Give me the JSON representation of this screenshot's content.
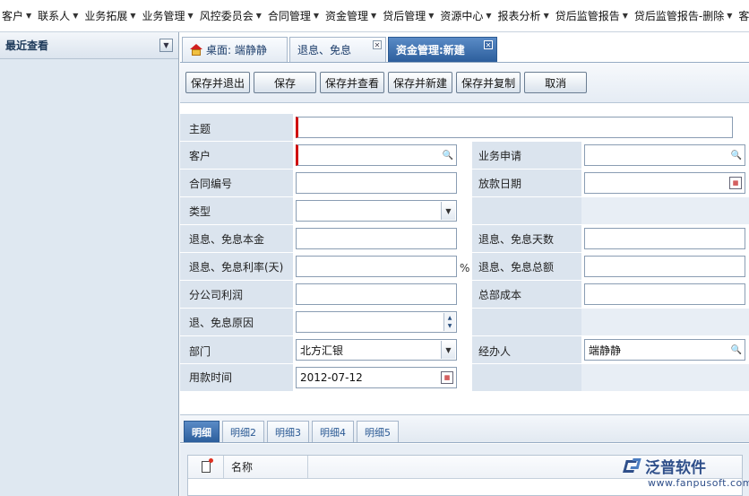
{
  "menubar": {
    "items": [
      "客户",
      "联系人",
      "业务拓展",
      "业务管理",
      "风控委员会",
      "合同管理",
      "资金管理",
      "贷后管理",
      "资源中心",
      "报表分析",
      "贷后监管报告",
      "贷后监管报告-删除",
      "客户安"
    ]
  },
  "leftpanel": {
    "title": "最近查看"
  },
  "tabs": {
    "home": "桌面: 端静静",
    "second": "退息、免息",
    "active": "资金管理:新建"
  },
  "toolbar": {
    "save_exit": "保存并退出",
    "save": "保存",
    "save_view": "保存并查看",
    "save_new": "保存并新建",
    "save_copy": "保存并复制",
    "cancel": "取消"
  },
  "form": {
    "subject_label": "主题",
    "subject_value": "",
    "customer_label": "客户",
    "customer_value": "",
    "biz_apply_label": "业务申请",
    "biz_apply_value": "",
    "contract_no_label": "合同编号",
    "contract_no_value": "",
    "loan_date_label": "放款日期",
    "loan_date_value": "",
    "type_label": "类型",
    "type_value": "",
    "principal_label": "退息、免息本金",
    "principal_value": "",
    "days_label": "退息、免息天数",
    "days_value": "",
    "rate_label": "退息、免息利率(天)",
    "rate_value": "",
    "rate_unit": "%",
    "total_label": "退息、免息总额",
    "total_value": "",
    "branch_profit_label": "分公司利润",
    "branch_profit_value": "",
    "hq_cost_label": "总部成本",
    "hq_cost_value": "",
    "reason_label": "退、免息原因",
    "reason_value": "",
    "dept_label": "部门",
    "dept_value": "北方汇银",
    "handler_label": "经办人",
    "handler_value": "端静静",
    "use_time_label": "用款时间",
    "use_time_value": "2012-07-12"
  },
  "detail": {
    "tabs": [
      "明细",
      "明细2",
      "明细3",
      "明细4",
      "明细5"
    ],
    "grid_col_name": "名称"
  },
  "watermark": {
    "brand": "泛普软件",
    "url": "www.fanpusoft.com"
  },
  "colors": {
    "accent": "#2c5e9c",
    "label_bg": "#dbe4ee",
    "required": "#d01010"
  }
}
